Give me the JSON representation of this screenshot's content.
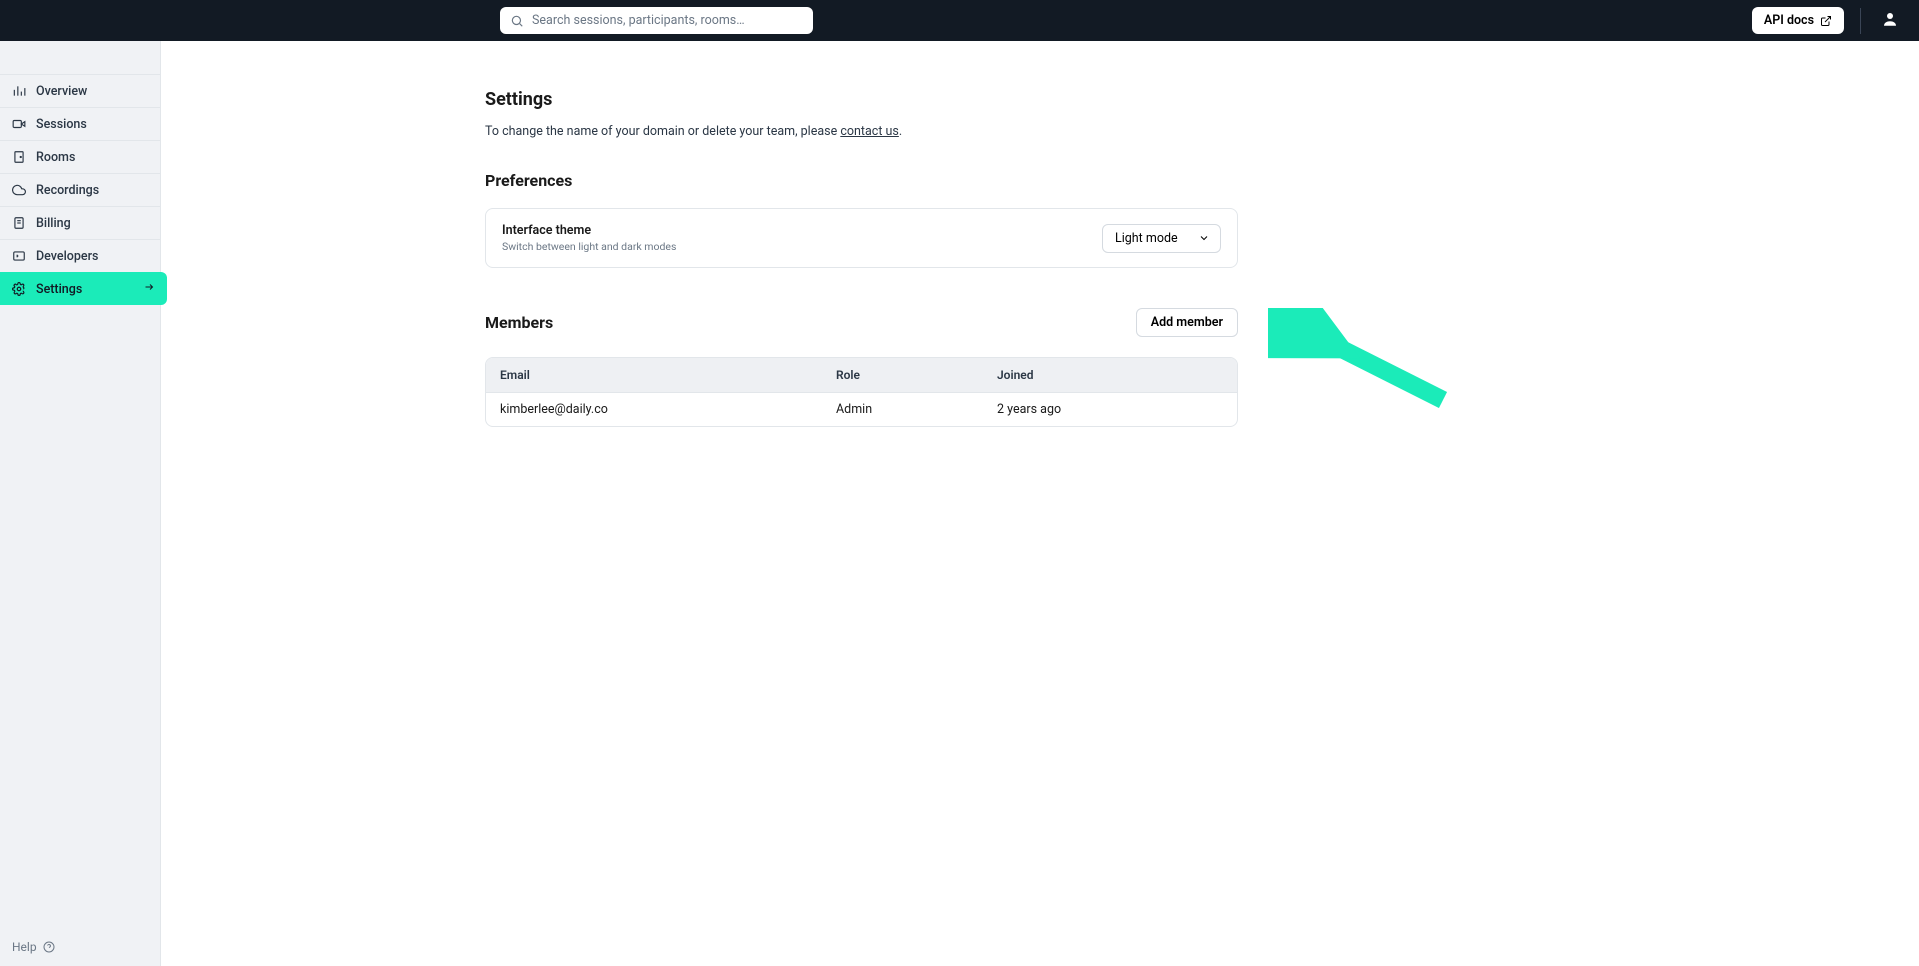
{
  "header": {
    "search_placeholder": "Search sessions, participants, rooms…",
    "api_docs": "API docs"
  },
  "sidebar": {
    "items": [
      {
        "label": "Overview"
      },
      {
        "label": "Sessions"
      },
      {
        "label": "Rooms"
      },
      {
        "label": "Recordings"
      },
      {
        "label": "Billing"
      },
      {
        "label": "Developers"
      },
      {
        "label": "Settings"
      }
    ],
    "help": "Help"
  },
  "page": {
    "title": "Settings",
    "desc_prefix": "To change the name of your domain or delete your team, please ",
    "desc_link": "contact us",
    "desc_suffix": "."
  },
  "preferences": {
    "heading": "Preferences",
    "theme_label": "Interface theme",
    "theme_sub": "Switch between light and dark modes",
    "theme_value": "Light mode"
  },
  "members": {
    "heading": "Members",
    "add_button": "Add member",
    "columns": {
      "email": "Email",
      "role": "Role",
      "joined": "Joined"
    },
    "rows": [
      {
        "email": "kimberlee@daily.co",
        "role": "Admin",
        "joined": "2 years ago"
      }
    ]
  }
}
